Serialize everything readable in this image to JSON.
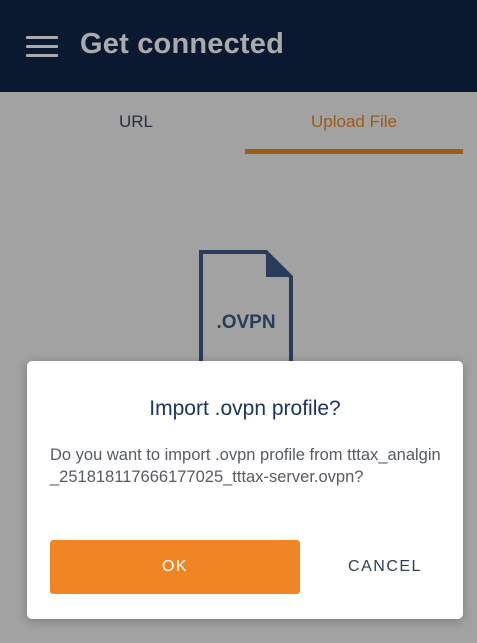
{
  "header": {
    "menu_icon": "hamburger-menu-icon",
    "title": "Get connected"
  },
  "tabs": [
    {
      "label": "URL",
      "active": false
    },
    {
      "label": "Upload File",
      "active": true
    }
  ],
  "content": {
    "file_icon": "ovpn-file-icon",
    "file_extension": ".OVPN"
  },
  "dialog": {
    "title": "Import .ovpn profile?",
    "message": "Do you want to import .ovpn profile from tttax_analgin_251818117666177025_tttax-server.ovpn?",
    "ok_label": "OK",
    "cancel_label": "CANCEL"
  },
  "colors": {
    "header_bg": "#102648",
    "accent": "#e68a22",
    "ok_button": "#ef8523",
    "dialog_title": "#1b3560",
    "file_icon": "#3d5a8a"
  }
}
